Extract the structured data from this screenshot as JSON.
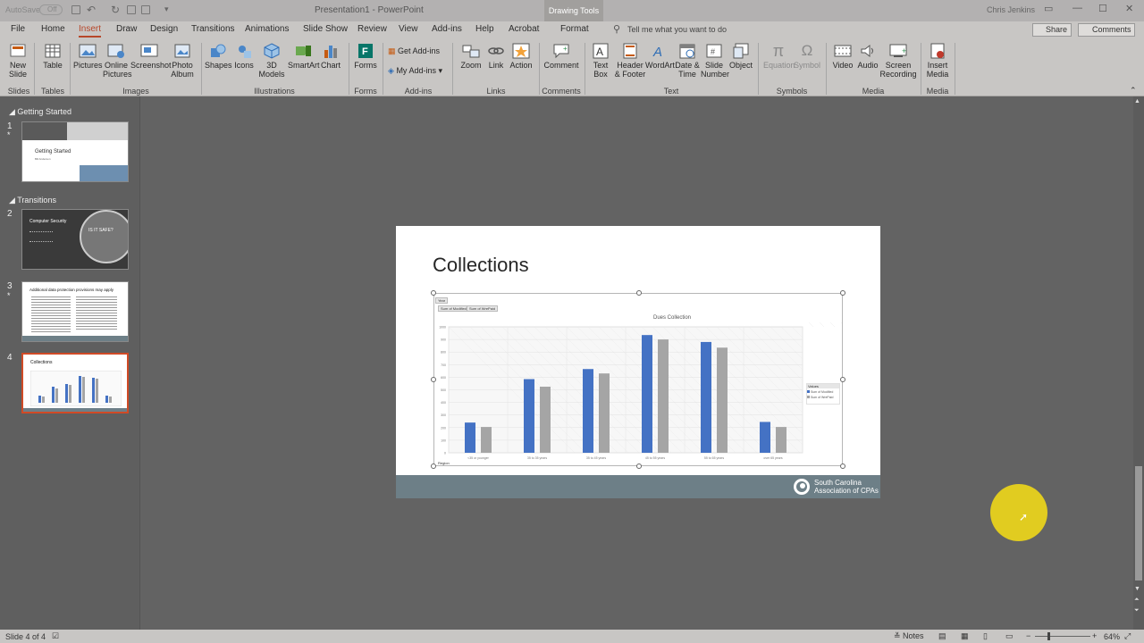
{
  "titlebar": {
    "autosave": "AutoSave",
    "autosave_state": "Off",
    "doc_title": "Presentation1 - PowerPoint",
    "context_tab": "Drawing Tools",
    "user": "Chris Jenkins"
  },
  "tabs": [
    "File",
    "Home",
    "Insert",
    "Draw",
    "Design",
    "Transitions",
    "Animations",
    "Slide Show",
    "Review",
    "View",
    "Add-ins",
    "Help",
    "Acrobat",
    "Format"
  ],
  "active_tab": "Insert",
  "tell_me": "Tell me what you want to do",
  "share": "Share",
  "comments": "Comments",
  "ribbon": {
    "new_slide": "New\nSlide",
    "table": "Table",
    "pictures": "Pictures",
    "online_pictures": "Online\nPictures",
    "screenshot": "Screenshot",
    "photo_album": "Photo\nAlbum",
    "shapes": "Shapes",
    "icons": "Icons",
    "models3d": "3D\nModels",
    "smartart": "SmartArt",
    "chart": "Chart",
    "forms": "Forms",
    "get_addins": "Get Add-ins",
    "my_addins": "My Add-ins",
    "zoom": "Zoom",
    "link": "Link",
    "action": "Action",
    "comment": "Comment",
    "text_box": "Text\nBox",
    "header_footer": "Header\n& Footer",
    "wordart": "WordArt",
    "date_time": "Date &\nTime",
    "slide_number": "Slide\nNumber",
    "object": "Object",
    "equation": "Equation",
    "symbol": "Symbol",
    "video": "Video",
    "audio": "Audio",
    "screen_recording": "Screen\nRecording",
    "insert_media": "Insert\nMedia",
    "groups": {
      "slides": "Slides",
      "tables": "Tables",
      "images": "Images",
      "illustrations": "Illustrations",
      "forms": "Forms",
      "addins": "Add-ins",
      "links": "Links",
      "comments": "Comments",
      "text": "Text",
      "symbols": "Symbols",
      "media": "Media",
      "media2": "Media"
    }
  },
  "thumbnails": {
    "section1": "Getting Started",
    "section2": "Transitions",
    "slides": [
      {
        "num": "1",
        "title": "Getting Started",
        "sub": "Bill Anderson"
      },
      {
        "num": "2",
        "title": "Computer Security",
        "sub": "IS IT SAFE?"
      },
      {
        "num": "3",
        "title": "Additional data protection provisions may apply",
        "sub": ""
      },
      {
        "num": "4",
        "title": "Collections",
        "sub": ""
      }
    ]
  },
  "slide": {
    "title": "Collections",
    "footer_org": "South Carolina\nAssociation of CPAs"
  },
  "chart_data": {
    "type": "bar",
    "title": "Dues Collection",
    "field_button": "Year",
    "value_buttons": [
      "Sum of Modified",
      "Sum of WrePaid"
    ],
    "categories": [
      "<35 or younger",
      "35 to 35 years",
      "35 to 45 years",
      "45 to 55 years",
      "55 to 65 years",
      "over 65 years"
    ],
    "series": [
      {
        "name": "Sum of Modified",
        "color": "#4472c4",
        "values": [
          240,
          585,
          665,
          935,
          880,
          245
        ]
      },
      {
        "name": "Sum of WrePaid",
        "color": "#a5a5a5",
        "values": [
          205,
          525,
          630,
          900,
          835,
          205
        ]
      }
    ],
    "ylim": [
      0,
      1000
    ],
    "yticks": [
      "0",
      "100",
      "200",
      "300",
      "400",
      "500",
      "600",
      "700",
      "800",
      "900",
      "1000"
    ],
    "legend_title": "Values",
    "legend_placement": "right",
    "bottom_button": "Region"
  },
  "status": {
    "slide_info": "Slide 4 of 4",
    "notes": "Notes",
    "zoom": "64%"
  }
}
